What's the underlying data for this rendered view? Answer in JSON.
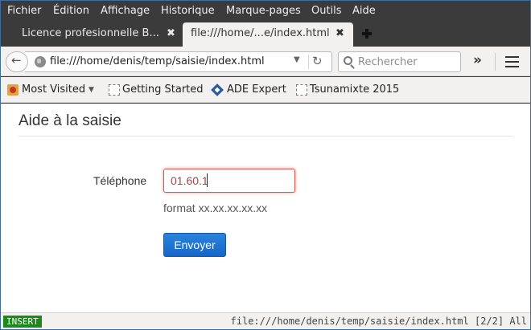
{
  "menu": [
    "Fichier",
    "Édition",
    "Affichage",
    "Historique",
    "Marque-pages",
    "Outils",
    "Aide"
  ],
  "tabs": [
    {
      "title": "Licence profesionnelle B...",
      "close": "✖"
    },
    {
      "title": "file:///home/...e/index.html",
      "close": "✖"
    }
  ],
  "nav": {
    "url": "file:///home/denis/temp/saisie/index.html",
    "search_placeholder": "Rechercher"
  },
  "bookmarks": [
    "Most Visited",
    "Getting Started",
    "ADE Expert",
    "Tsunamixte 2015"
  ],
  "page": {
    "title": "Aide à la saisie",
    "phone_label": "Téléphone",
    "phone_value": "01.60.1",
    "help": "format xx.xx.xx.xx.xx",
    "submit": "Envoyer"
  },
  "status": {
    "mode": "INSERT",
    "info": "file:///home/denis/temp/saisie/index.html [2/2] All"
  },
  "colors": {
    "error": "#d9534f",
    "primary": "#1666c7",
    "insert_badge": "#1b8a1b"
  },
  "icons": [
    "back-arrow-icon",
    "globe-icon",
    "chevron-down-icon",
    "reload-icon",
    "search-icon",
    "overflow-icon",
    "hamburger-menu-icon",
    "new-tab-icon"
  ]
}
